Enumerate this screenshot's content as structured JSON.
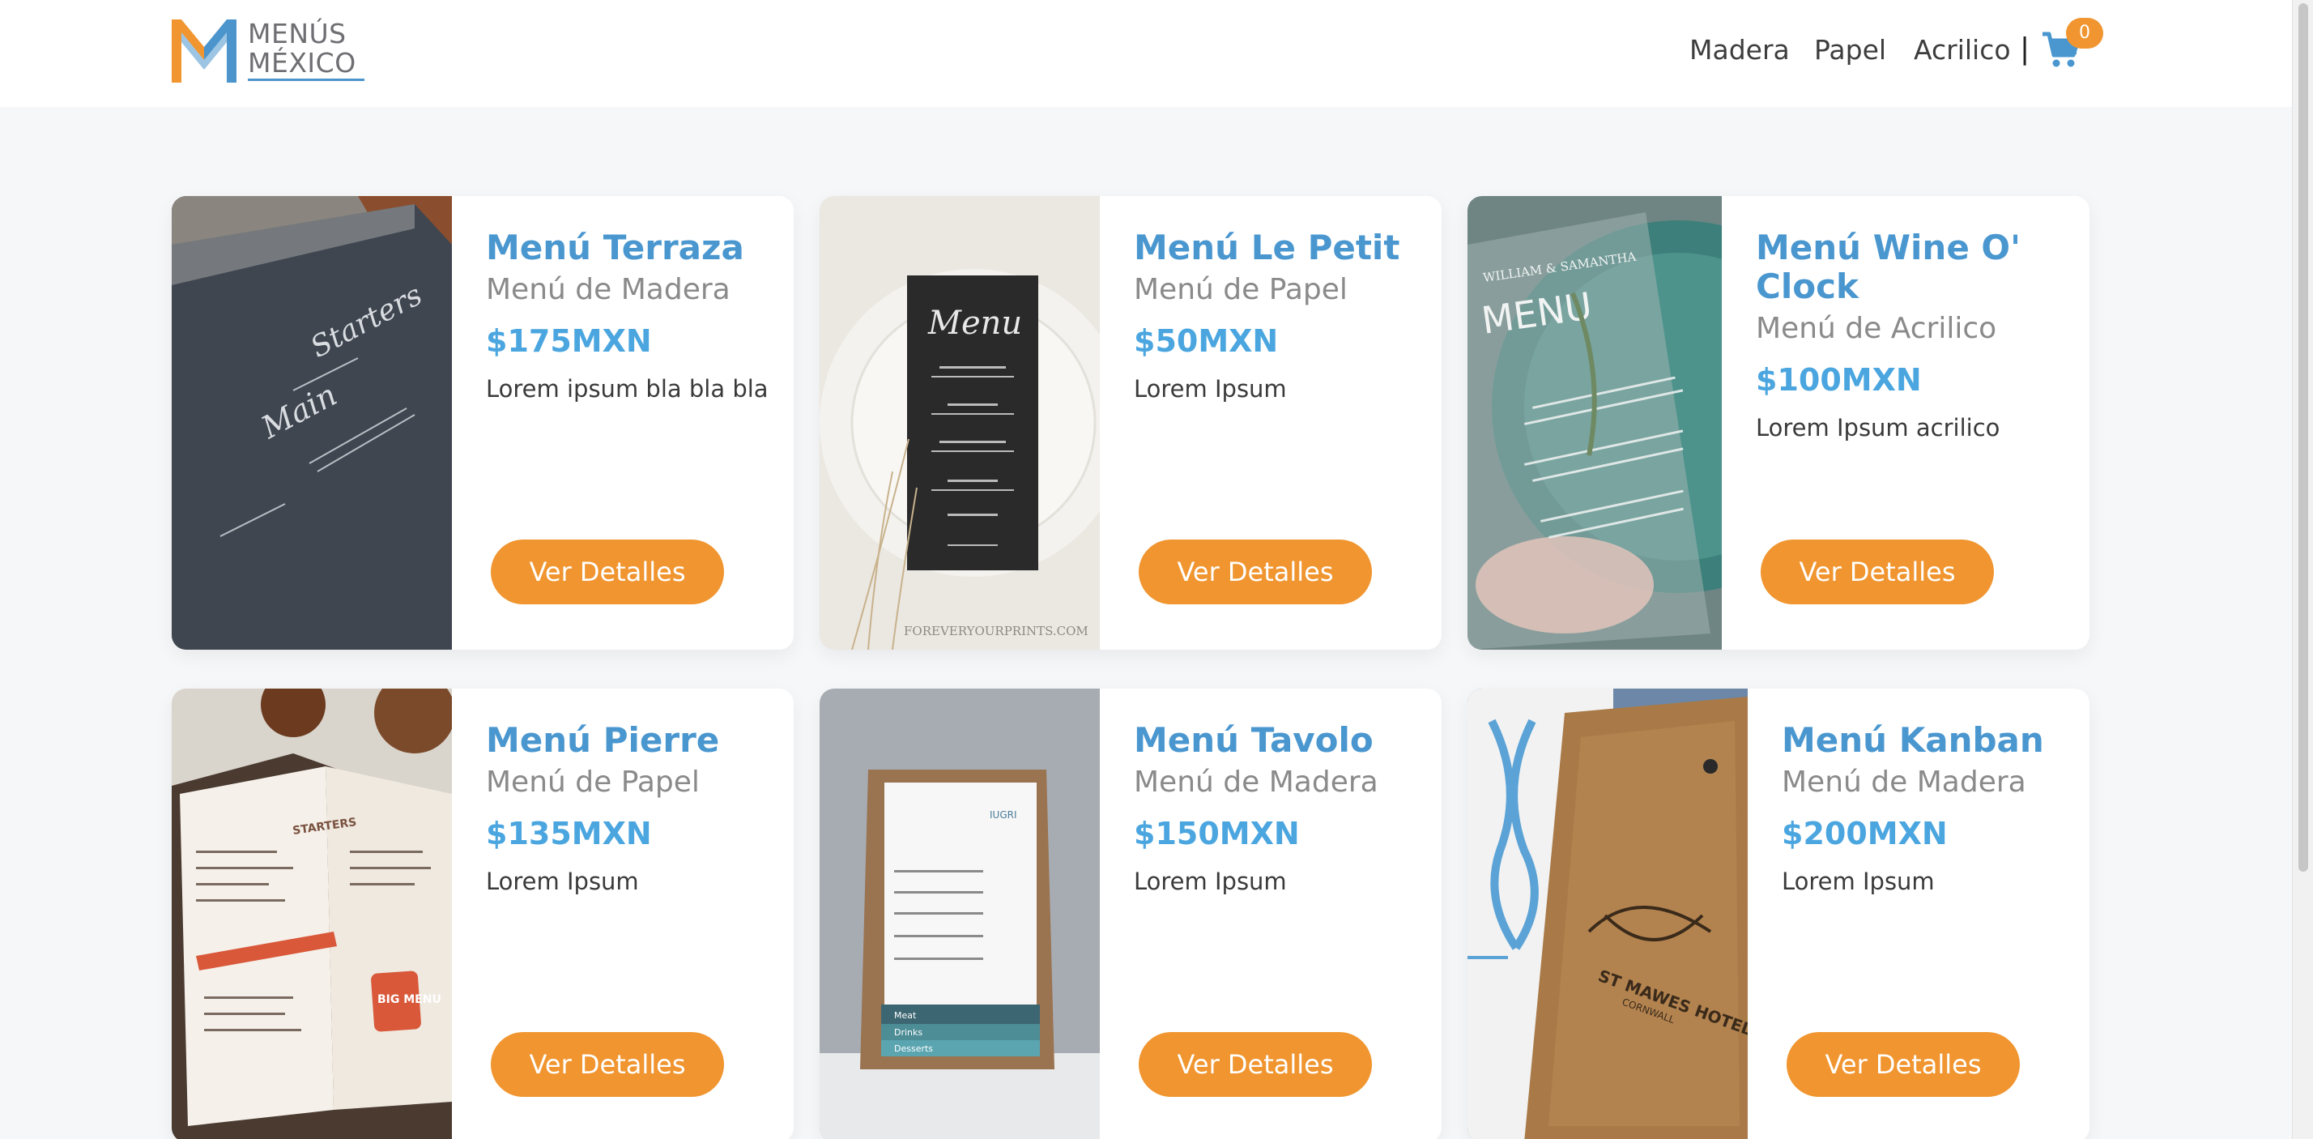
{
  "brand": {
    "line1": "MENÚS",
    "line2": "MÉXICO",
    "orange": "#f0952f",
    "blue": "#4b94cc"
  },
  "nav": {
    "items": [
      "Madera",
      "Papel",
      "Acrilico"
    ],
    "separator": "|",
    "cart_count": "0"
  },
  "cards": [
    {
      "title": "Menú Terraza",
      "category": "Menú de Madera",
      "price": "$175MXN",
      "description": "Lorem ipsum bla bla bla",
      "button": "Ver Detalles",
      "image": "dark-wood-menu-photo"
    },
    {
      "title": "Menú Le Petit",
      "category": "Menú de Papel",
      "price": "$50MXN",
      "description": "Lorem Ipsum",
      "button": "Ver Detalles",
      "image": "black-paper-menu-on-plate-photo"
    },
    {
      "title": "Menú Wine O' Clock",
      "category": "Menú de Acrilico",
      "price": "$100MXN",
      "description": "Lorem Ipsum acrilico",
      "button": "Ver Detalles",
      "image": "acrylic-menu-on-plate-photo"
    },
    {
      "title": "Menú Pierre",
      "category": "Menú de Papel",
      "price": "$135MXN",
      "description": "Lorem Ipsum",
      "button": "Ver Detalles",
      "image": "folded-paper-menu-photo"
    },
    {
      "title": "Menú Tavolo",
      "category": "Menú de Madera",
      "price": "$150MXN",
      "description": "Lorem Ipsum",
      "button": "Ver Detalles",
      "image": "wood-stand-menu-photo"
    },
    {
      "title": "Menú Kanban",
      "category": "Menú de Madera",
      "price": "$200MXN",
      "description": "Lorem Ipsum",
      "button": "Ver Detalles",
      "image": "wood-board-menu-photo"
    }
  ],
  "image_text": {
    "le_petit_heading": "Menu",
    "le_petit_watermark": "FOREVERYOURPRINTS.COM",
    "wine_heading": "MENU",
    "wine_couple": "WILLIAM & SAMANTHA",
    "tavolo_brand": "IUGRI",
    "tavolo_tabs": [
      "Meat",
      "Drinks",
      "Desserts"
    ],
    "kanban_brand": "ST MAWES HOTEL",
    "kanban_sub": "CORNWALL",
    "pierre_header": "STARTERS",
    "pierre_badge": "BIG MENU",
    "terraza_word1": "Starters",
    "terraza_word2": "Main"
  }
}
